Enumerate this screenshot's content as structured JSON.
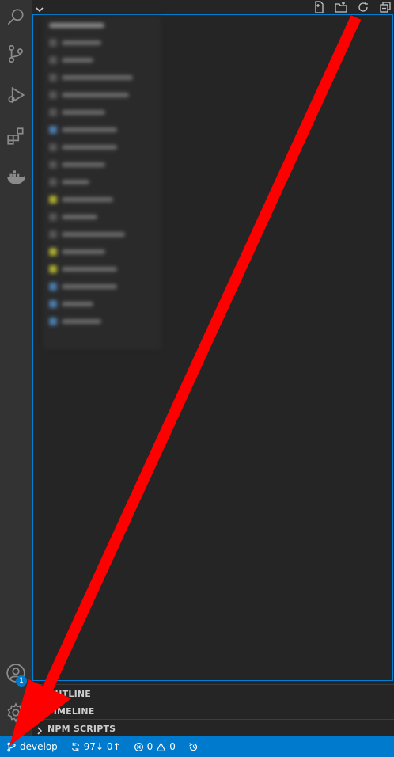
{
  "activity_bar": {
    "icons": [
      "search-icon",
      "source-control-icon",
      "run-debug-icon",
      "extensions-icon",
      "docker-icon",
      "account-icon",
      "gear-icon"
    ],
    "account_badge": "1"
  },
  "explorer": {
    "header_actions": [
      "new-file-icon",
      "new-folder-icon",
      "refresh-icon",
      "collapse-all-icon"
    ]
  },
  "panels": {
    "outline": "OUTLINE",
    "timeline": "TIMELINE",
    "npm_scripts": "NPM SCRIPTS"
  },
  "status_bar": {
    "branch": "develop",
    "sync": "97↓ 0↑",
    "errors": "0",
    "warnings": "0"
  },
  "colors": {
    "status_bar": "#007acc",
    "annotation_arrow": "#ff0000"
  }
}
